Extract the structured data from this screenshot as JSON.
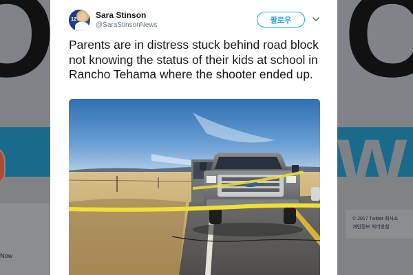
{
  "tweet": {
    "display_name": "Sara Stinson",
    "handle": "@SaraStinsonNews",
    "follow_label": "팔로우",
    "text": "Parents are in distress stuck behind road block not knowing the status of their kids at school in Rancho Tehama where the shooter ended up.",
    "avatar_badge": "12"
  },
  "background": {
    "now_label": "Now",
    "footer_line1": "© 2017 Twitter    회사소",
    "footer_line2": "개인정보 처리방침"
  },
  "icons": {
    "menu": "chevron-down-icon"
  },
  "colors": {
    "accent": "#1da1f2",
    "text": "#14171a",
    "secondary": "#657786",
    "banner": "#1a6a8c"
  }
}
